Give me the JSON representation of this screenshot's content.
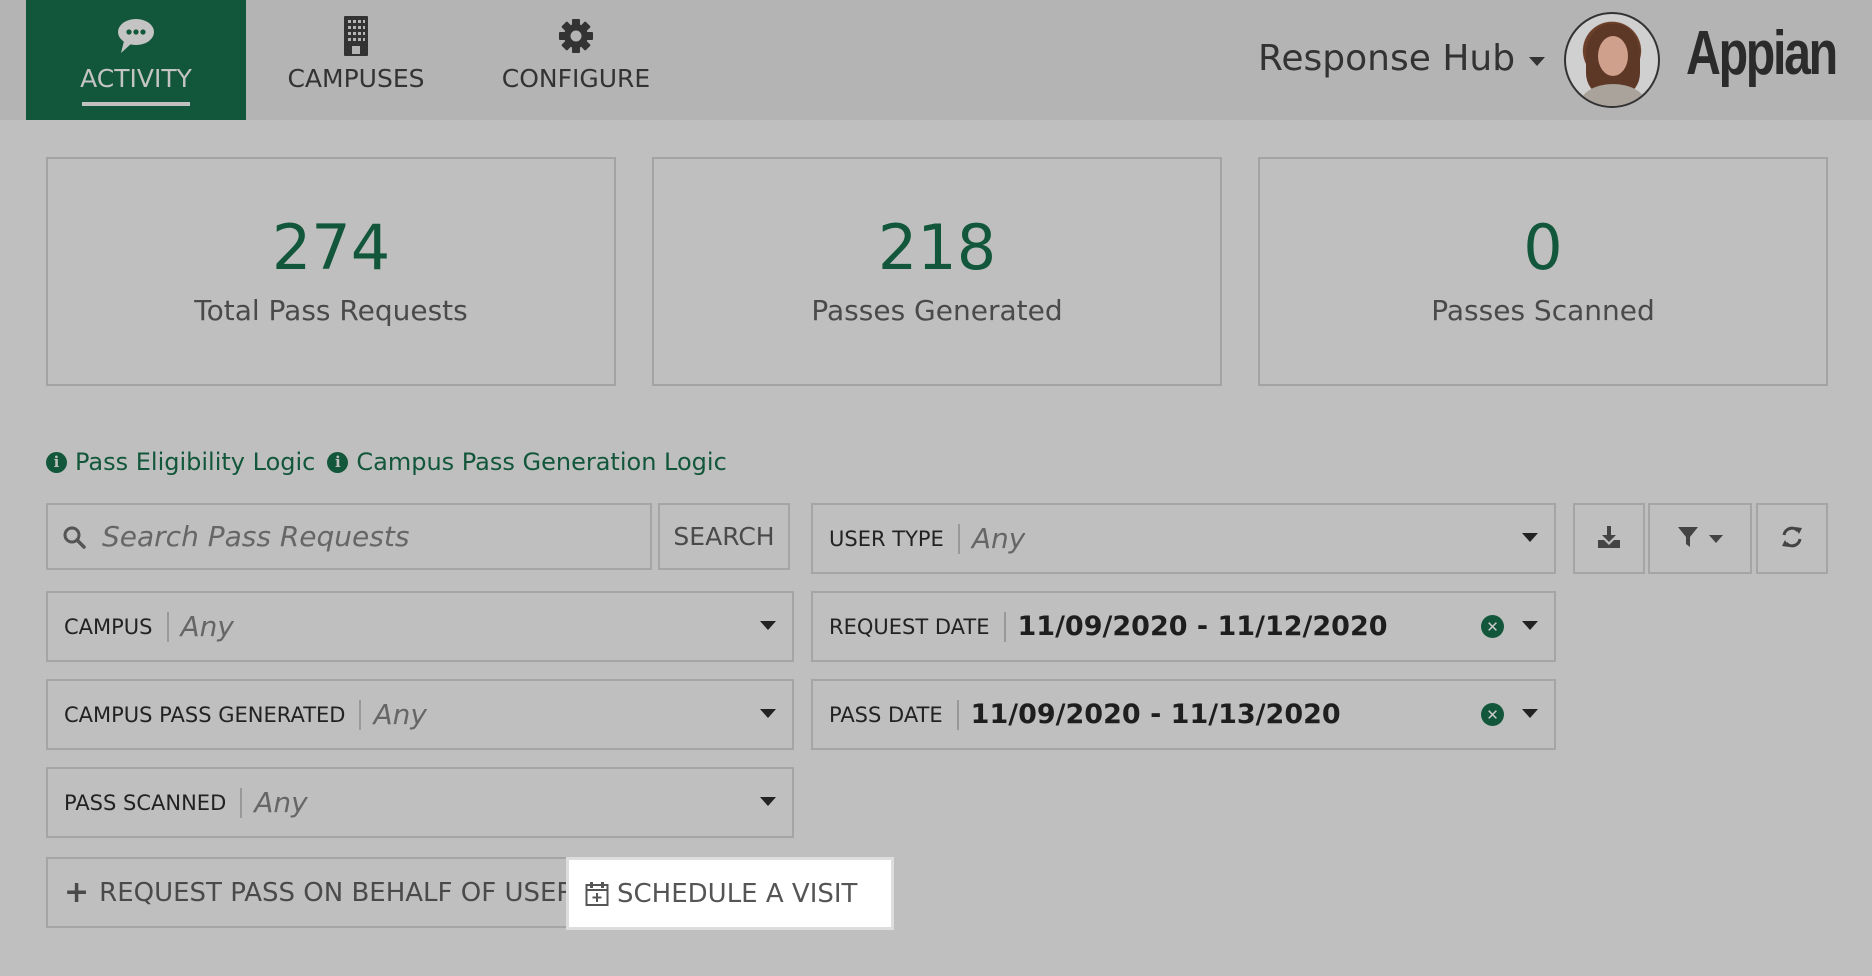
{
  "header": {
    "tabs": [
      {
        "label": "ACTIVITY",
        "icon": "chat-bubble-icon",
        "active": true
      },
      {
        "label": "CAMPUSES",
        "icon": "building-icon",
        "active": false
      },
      {
        "label": "CONFIGURE",
        "icon": "gear-icon",
        "active": false
      }
    ],
    "app_name": "Response Hub",
    "logo": "Appian"
  },
  "stats": [
    {
      "value": "274",
      "label": "Total Pass Requests"
    },
    {
      "value": "218",
      "label": "Passes Generated"
    },
    {
      "value": "0",
      "label": "Passes Scanned"
    }
  ],
  "links": [
    {
      "label": "Pass Eligibility Logic",
      "icon": "info-icon"
    },
    {
      "label": "Campus Pass Generation Logic",
      "icon": "info-icon"
    }
  ],
  "search": {
    "placeholder": "Search Pass Requests",
    "value": "",
    "button_label": "SEARCH"
  },
  "filters": {
    "user_type": {
      "label": "USER TYPE",
      "value": "Any"
    },
    "campus": {
      "label": "CAMPUS",
      "value": "Any"
    },
    "request_date": {
      "label": "REQUEST DATE",
      "value": "11/09/2020 - 11/12/2020"
    },
    "campus_pass_generated": {
      "label": "CAMPUS PASS GENERATED",
      "value": "Any"
    },
    "pass_date": {
      "label": "PASS DATE",
      "value": "11/09/2020 - 11/13/2020"
    },
    "pass_scanned": {
      "label": "PASS SCANNED",
      "value": "Any"
    }
  },
  "toolbar": {
    "download_icon": "download-icon",
    "filter_icon": "filter-icon",
    "refresh_icon": "refresh-icon"
  },
  "actions": {
    "request_pass_label": "REQUEST PASS ON BEHALF OF USER",
    "schedule_visit_label": "SCHEDULE A VISIT"
  },
  "colors": {
    "brand_green": "#12573b",
    "header_bg": "#b4b4b4",
    "page_bg": "#bfbfbf",
    "highlight_bg": "#ffffff"
  }
}
